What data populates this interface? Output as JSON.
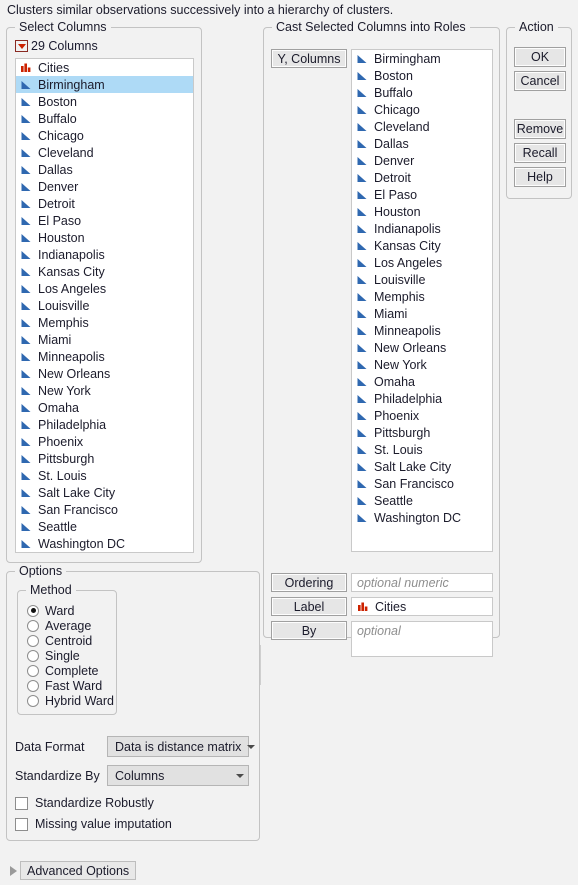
{
  "description": "Clusters similar observations successively into a hierarchy of clusters.",
  "select_columns": {
    "legend": "Select Columns",
    "count_label": "29 Columns",
    "dropdown_icon": "red-triangle-icon",
    "selected_item": "Birmingham",
    "items": [
      {
        "name": "Cities",
        "type": "nominal"
      },
      {
        "name": "Birmingham",
        "type": "continuous"
      },
      {
        "name": "Boston",
        "type": "continuous"
      },
      {
        "name": "Buffalo",
        "type": "continuous"
      },
      {
        "name": "Chicago",
        "type": "continuous"
      },
      {
        "name": "Cleveland",
        "type": "continuous"
      },
      {
        "name": "Dallas",
        "type": "continuous"
      },
      {
        "name": "Denver",
        "type": "continuous"
      },
      {
        "name": "Detroit",
        "type": "continuous"
      },
      {
        "name": "El Paso",
        "type": "continuous"
      },
      {
        "name": "Houston",
        "type": "continuous"
      },
      {
        "name": "Indianapolis",
        "type": "continuous"
      },
      {
        "name": "Kansas City",
        "type": "continuous"
      },
      {
        "name": "Los Angeles",
        "type": "continuous"
      },
      {
        "name": "Louisville",
        "type": "continuous"
      },
      {
        "name": "Memphis",
        "type": "continuous"
      },
      {
        "name": "Miami",
        "type": "continuous"
      },
      {
        "name": "Minneapolis",
        "type": "continuous"
      },
      {
        "name": "New Orleans",
        "type": "continuous"
      },
      {
        "name": "New York",
        "type": "continuous"
      },
      {
        "name": "Omaha",
        "type": "continuous"
      },
      {
        "name": "Philadelphia",
        "type": "continuous"
      },
      {
        "name": "Phoenix",
        "type": "continuous"
      },
      {
        "name": "Pittsburgh",
        "type": "continuous"
      },
      {
        "name": "St. Louis",
        "type": "continuous"
      },
      {
        "name": "Salt Lake City",
        "type": "continuous"
      },
      {
        "name": "San Francisco",
        "type": "continuous"
      },
      {
        "name": "Seattle",
        "type": "continuous"
      },
      {
        "name": "Washington DC",
        "type": "continuous"
      }
    ]
  },
  "cast_roles": {
    "legend": "Cast Selected Columns into Roles",
    "y_columns": {
      "button_label": "Y, Columns",
      "items": [
        {
          "name": "Birmingham",
          "type": "continuous"
        },
        {
          "name": "Boston",
          "type": "continuous"
        },
        {
          "name": "Buffalo",
          "type": "continuous"
        },
        {
          "name": "Chicago",
          "type": "continuous"
        },
        {
          "name": "Cleveland",
          "type": "continuous"
        },
        {
          "name": "Dallas",
          "type": "continuous"
        },
        {
          "name": "Denver",
          "type": "continuous"
        },
        {
          "name": "Detroit",
          "type": "continuous"
        },
        {
          "name": "El Paso",
          "type": "continuous"
        },
        {
          "name": "Houston",
          "type": "continuous"
        },
        {
          "name": "Indianapolis",
          "type": "continuous"
        },
        {
          "name": "Kansas City",
          "type": "continuous"
        },
        {
          "name": "Los Angeles",
          "type": "continuous"
        },
        {
          "name": "Louisville",
          "type": "continuous"
        },
        {
          "name": "Memphis",
          "type": "continuous"
        },
        {
          "name": "Miami",
          "type": "continuous"
        },
        {
          "name": "Minneapolis",
          "type": "continuous"
        },
        {
          "name": "New Orleans",
          "type": "continuous"
        },
        {
          "name": "New York",
          "type": "continuous"
        },
        {
          "name": "Omaha",
          "type": "continuous"
        },
        {
          "name": "Philadelphia",
          "type": "continuous"
        },
        {
          "name": "Phoenix",
          "type": "continuous"
        },
        {
          "name": "Pittsburgh",
          "type": "continuous"
        },
        {
          "name": "St. Louis",
          "type": "continuous"
        },
        {
          "name": "Salt Lake City",
          "type": "continuous"
        },
        {
          "name": "San Francisco",
          "type": "continuous"
        },
        {
          "name": "Seattle",
          "type": "continuous"
        },
        {
          "name": "Washington DC",
          "type": "continuous"
        }
      ]
    },
    "ordering": {
      "button_label": "Ordering",
      "value": "",
      "placeholder": "optional numeric"
    },
    "label": {
      "button_label": "Label",
      "value": "Cities",
      "value_type": "nominal",
      "placeholder": ""
    },
    "by": {
      "button_label": "By",
      "value": "",
      "placeholder": "optional"
    }
  },
  "action": {
    "legend": "Action",
    "ok": "OK",
    "cancel": "Cancel",
    "remove": "Remove",
    "recall": "Recall",
    "help": "Help"
  },
  "options": {
    "legend": "Options",
    "method": {
      "legend": "Method",
      "selected": "Ward",
      "items": [
        "Ward",
        "Average",
        "Centroid",
        "Single",
        "Complete",
        "Fast Ward",
        "Hybrid Ward"
      ]
    },
    "data_format": {
      "label": "Data Format",
      "value": "Data is distance matrix"
    },
    "standardize_by": {
      "label": "Standardize By",
      "value": "Columns"
    },
    "standardize_robustly": {
      "label": "Standardize Robustly",
      "checked": false
    },
    "missing_value_imputation": {
      "label": "Missing value imputation",
      "checked": false
    }
  },
  "advanced_options": {
    "label": "Advanced Options",
    "expanded": false
  },
  "colors": {
    "nominal_icon": "#cc2200",
    "continuous_icon": "#2f68b0",
    "selection_highlight": "#aedaf6",
    "window_background": "#f2f2f2",
    "button_face": "#e6e6e6"
  }
}
